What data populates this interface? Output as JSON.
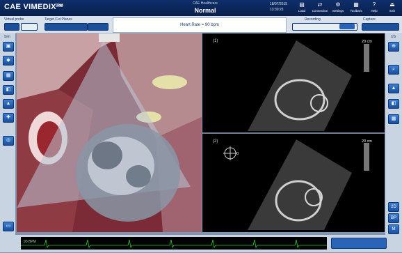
{
  "header": {
    "app_title": "CAE VIMEDIX™",
    "user": "Bob",
    "center_subtitle": "CAE Healthcare",
    "mode": "Normal",
    "date": "18/07/2015",
    "time": "13:30:25",
    "buttons": [
      {
        "label": "Load",
        "icon": "folder-icon"
      },
      {
        "label": "Connection",
        "icon": "connection-icon"
      },
      {
        "label": "Settings",
        "icon": "gear-icon"
      },
      {
        "label": "Toolbars",
        "icon": "toolbars-icon"
      },
      {
        "label": "Help",
        "icon": "help-icon"
      },
      {
        "label": "Exit",
        "icon": "exit-icon"
      }
    ]
  },
  "controls": {
    "virtual_probe": "Virtual probe",
    "target_cut_planes": "Target Cut Planes",
    "heart_rate": "Heart Rate = 90 bpm",
    "recording": "Recording",
    "capture": "Capture"
  },
  "left_rail": {
    "sim_label": "Sim"
  },
  "right_rail": {
    "us_label": "US",
    "buttons": [
      "2D",
      "BP",
      "M"
    ]
  },
  "ultrasound": {
    "pane1": {
      "num": "(1)",
      "depth": "20 cm"
    },
    "pane2": {
      "num": "(2)",
      "depth": "20 cm",
      "marker": "0"
    }
  },
  "ecg": {
    "bpm": "90 BPM"
  },
  "colors": {
    "brand": "#0f2f6a",
    "button": "#2a64b8",
    "ecg": "#33cc33"
  }
}
